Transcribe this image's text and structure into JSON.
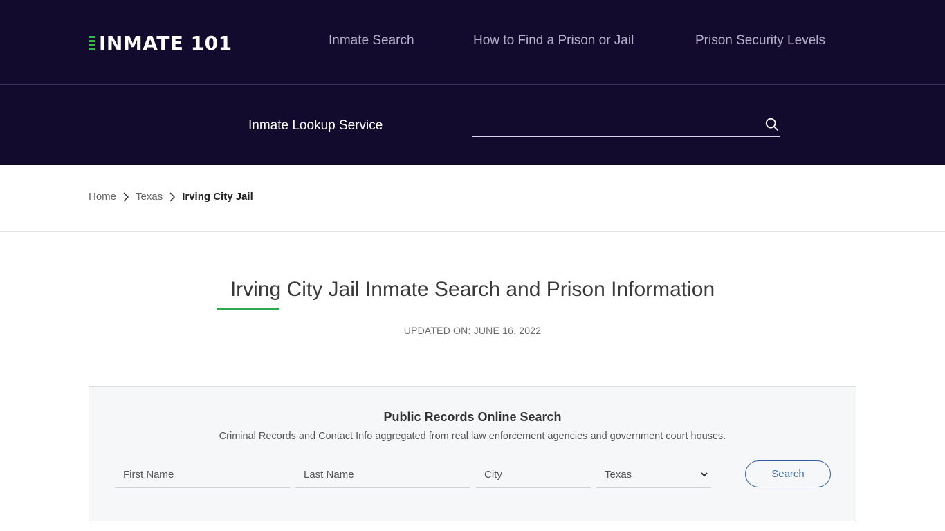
{
  "header": {
    "logo_text": "INMATE 101",
    "nav": [
      {
        "label": "Inmate Search"
      },
      {
        "label": "How to Find a Prison or Jail"
      },
      {
        "label": "Prison Security Levels"
      }
    ]
  },
  "lookup": {
    "label": "Inmate Lookup Service",
    "input_value": "",
    "placeholder": "",
    "icon": "search-icon"
  },
  "breadcrumb": {
    "items": [
      {
        "label": "Home"
      },
      {
        "label": "Texas"
      },
      {
        "label": "Irving City Jail"
      }
    ]
  },
  "page": {
    "title": "Irving City Jail Inmate Search and Prison Information",
    "updated": "UPDATED ON: JUNE 16, 2022"
  },
  "search_card": {
    "title": "Public Records Online Search",
    "subtitle": "Criminal Records and Contact Info aggregated from real law enforcement agencies and government court houses.",
    "first_name_placeholder": "First Name",
    "last_name_placeholder": "Last Name",
    "city_placeholder": "City",
    "state_selected": "Texas",
    "search_label": "Search"
  },
  "colors": {
    "header_bg": "#130b2e",
    "accent_green": "#2fa84f",
    "button_blue": "#2f5fa8"
  }
}
